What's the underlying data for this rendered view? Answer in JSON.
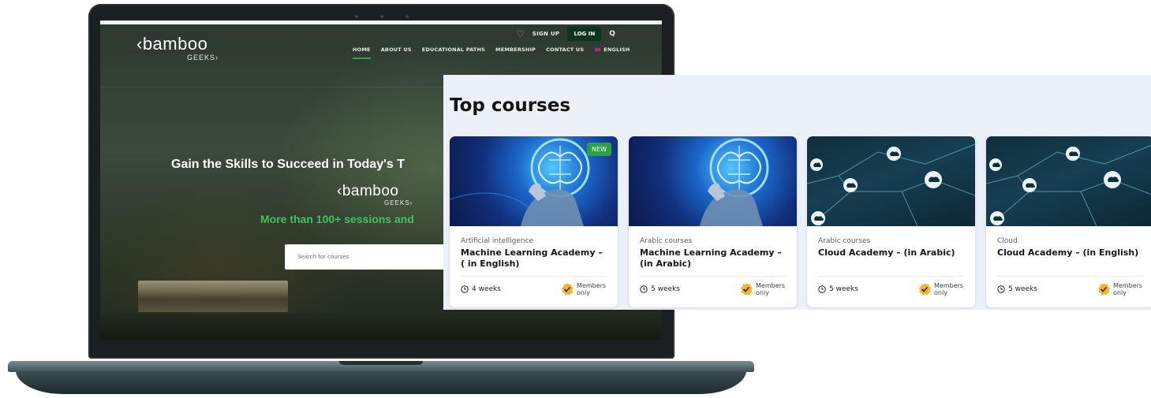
{
  "site": {
    "logo_main": "‹bamboo",
    "logo_sub": "GEEKS›",
    "top_actions": {
      "sign_up": "SIGN UP",
      "log_in": "LOG IN",
      "search_glyph": "Q"
    },
    "menu": [
      {
        "label": "HOME",
        "active": true
      },
      {
        "label": "ABOUT US"
      },
      {
        "label": "EDUCATIONAL PATHS"
      },
      {
        "label": "MEMBERSHIP"
      },
      {
        "label": "CONTACT US"
      },
      {
        "label": "ENGLISH"
      }
    ],
    "hero": {
      "title": "Gain the Skills to Succeed in Today's T",
      "logo_main": "‹bamboo",
      "logo_sub": "GEEKS›",
      "subtitle": "More than 100+ sessions and",
      "search_placeholder": "Search for courses"
    }
  },
  "top_courses": {
    "title": "Top courses",
    "cards": [
      {
        "category": "Artificial intelligence",
        "title": "Machine Learning Academy – ( in English)",
        "duration": "4 weeks",
        "members": "Members only",
        "badge": "NEW",
        "image": "ai-brain"
      },
      {
        "category": "Arabic courses",
        "title": "Machine Learning Academy – (in Arabic)",
        "duration": "5 weeks",
        "members": "Members only",
        "badge": "",
        "image": "ai-brain"
      },
      {
        "category": "Arabic courses",
        "title": "Cloud Academy – (in Arabic)",
        "duration": "5 weeks",
        "members": "Members only",
        "badge": "",
        "image": "cloud-network"
      },
      {
        "category": "Cloud",
        "title": "Cloud Academy – (in English)",
        "duration": "5 weeks",
        "members": "Members only",
        "badge": "",
        "image": "cloud-network"
      }
    ]
  },
  "colors": {
    "accent_green": "#2e9e47",
    "login_bg": "#0d3420",
    "hero_subtitle": "#3ec35d",
    "panel_bg": "#ecf0f8"
  }
}
